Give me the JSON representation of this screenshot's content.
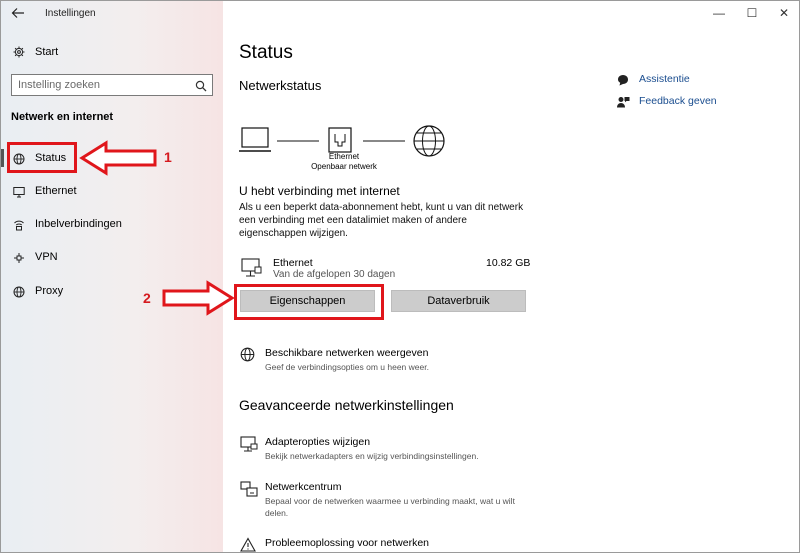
{
  "window": {
    "app_title": "Instellingen",
    "controls": {
      "minimize": "—",
      "maximize": "☐",
      "close": "✕"
    }
  },
  "sidebar": {
    "home_label": "Start",
    "search_placeholder": "Instelling zoeken",
    "section_label": "Netwerk en internet",
    "items": [
      {
        "label": "Status",
        "icon": "globe-icon"
      },
      {
        "label": "Ethernet",
        "icon": "monitor-icon"
      },
      {
        "label": "Inbelverbindingen",
        "icon": "dialup-icon"
      },
      {
        "label": "VPN",
        "icon": "vpn-icon"
      },
      {
        "label": "Proxy",
        "icon": "globe-icon"
      }
    ]
  },
  "main": {
    "title": "Status",
    "network_status_title": "Netwerkstatus",
    "diagram_label_1": "Ethernet",
    "diagram_label_2": "Openbaar netwerk",
    "connected_title": "U hebt verbinding met internet",
    "connected_desc": "Als u een beperkt data-abonnement hebt, kunt u van dit netwerk een verbinding met een datalimiet maken of andere eigenschappen wijzigen.",
    "ethernet": {
      "name": "Ethernet",
      "subtitle": "Van de afgelopen 30 dagen",
      "size": "10.82 GB"
    },
    "buttons": {
      "properties": "Eigenschappen",
      "data_usage": "Dataverbruik"
    },
    "available_networks": {
      "title": "Beschikbare netwerken weergeven",
      "desc": "Geef de verbindingsopties om u heen weer."
    },
    "advanced_heading": "Geavanceerde netwerkinstellingen",
    "links": [
      {
        "title": "Adapteropties wijzigen",
        "desc": "Bekijk netwerkadapters en wijzig verbindingsinstellingen."
      },
      {
        "title": "Netwerkcentrum",
        "desc": "Bepaal voor de netwerken waarmee u verbinding maakt, wat u wilt delen."
      },
      {
        "title": "Probleemoplossing voor netwerken",
        "desc": ""
      }
    ]
  },
  "right_links": [
    {
      "label": "Assistentie",
      "icon": "help-icon"
    },
    {
      "label": "Feedback geven",
      "icon": "feedback-icon"
    }
  ],
  "annotations": {
    "label_1": "1",
    "label_2": "2",
    "color": "#e0161b"
  }
}
